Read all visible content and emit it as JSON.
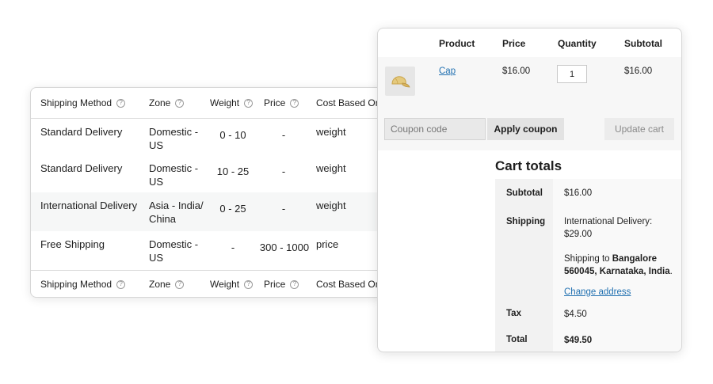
{
  "shipping_table": {
    "headers": {
      "method": "Shipping Method",
      "zone": "Zone",
      "weight": "Weight",
      "price": "Price",
      "cost_based_on": "Cost Based On"
    },
    "help_icon_glyph": "?",
    "rows": [
      {
        "method": "Standard Delivery",
        "zone": "Domestic - US",
        "weight": "0  -  10",
        "price": "-",
        "cost_based_on": "weight"
      },
      {
        "method": "Standard Delivery",
        "zone": "Domestic - US",
        "weight": "10  -  25",
        "price": "-",
        "cost_based_on": "weight"
      },
      {
        "method": "International Delivery",
        "zone": "Asia - India/ China",
        "weight": "0  -  25",
        "price": "-",
        "cost_based_on": "weight"
      },
      {
        "method": "Free Shipping",
        "zone": "Domestic - US",
        "weight": "-",
        "price": "300 - 1000",
        "cost_based_on": "price"
      }
    ]
  },
  "cart": {
    "headers": {
      "product": "Product",
      "price": "Price",
      "quantity": "Quantity",
      "subtotal": "Subtotal"
    },
    "item": {
      "name": "Cap",
      "price": "$16.00",
      "quantity": "1",
      "subtotal": "$16.00",
      "thumbnail_icon": "cap-thumbnail-icon"
    },
    "coupon": {
      "placeholder": "Coupon code",
      "apply_label": "Apply coupon"
    },
    "update_label": "Update cart"
  },
  "cart_totals": {
    "title": "Cart totals",
    "subtotal_label": "Subtotal",
    "subtotal_value": "$16.00",
    "shipping_label": "Shipping",
    "shipping_method": "International Delivery:",
    "shipping_cost": "$29.00",
    "shipping_to_prefix": "Shipping to ",
    "shipping_address_line1": "Bangalore",
    "shipping_address_line2": "560045, Karnataka, India",
    "shipping_address_end": ".",
    "change_address": "Change address",
    "tax_label": "Tax",
    "tax_value": "$4.50",
    "total_label": "Total",
    "total_value": "$49.50"
  },
  "colors": {
    "link": "#2271b1",
    "button_bg": "#e3e3e3",
    "row_alt": "#f6f7f7"
  }
}
